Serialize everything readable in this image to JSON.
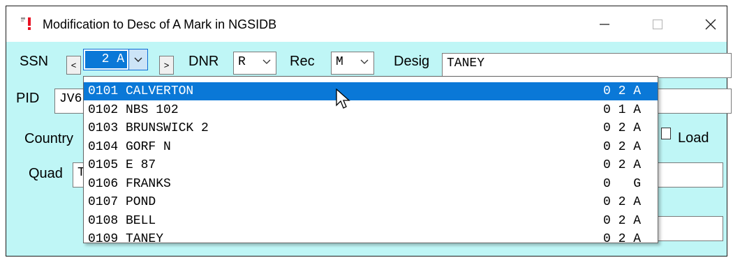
{
  "window": {
    "title": "Modification to Desc of A Mark in NGSIDB",
    "minimize": "—",
    "maximize": "☐",
    "close": "✕"
  },
  "ssn": {
    "label": "SSN",
    "prev": "<",
    "next": ">",
    "value": "2 A"
  },
  "dnr": {
    "label": "DNR",
    "value": "R"
  },
  "rec": {
    "label": "Rec",
    "value": "M"
  },
  "desig": {
    "label": "Desig",
    "value": "TANEY"
  },
  "pid": {
    "label": "PID",
    "value": "JV6"
  },
  "country": {
    "label": "Country"
  },
  "load": {
    "label": "Load"
  },
  "quad": {
    "label": "Quad",
    "value": "T"
  },
  "dropdown": {
    "items": [
      {
        "name": "0101 CALVERTON",
        "code": "0 2 A",
        "selected": true
      },
      {
        "name": "0102 NBS 102",
        "code": "0 1 A"
      },
      {
        "name": "0103 BRUNSWICK 2",
        "code": "0 2 A"
      },
      {
        "name": "0104 GORF N",
        "code": "0 2 A"
      },
      {
        "name": "0105 E 87",
        "code": "0 2 A"
      },
      {
        "name": "0106 FRANKS",
        "code": "0   G"
      },
      {
        "name": "0107 POND",
        "code": "0 2 A"
      },
      {
        "name": "0108 BELL",
        "code": "0 2 A"
      },
      {
        "name": "0109 TANEY",
        "code": "0 2 A"
      }
    ]
  },
  "colors": {
    "window_bg": "#bff6f6",
    "selection": "#0a78d7"
  }
}
